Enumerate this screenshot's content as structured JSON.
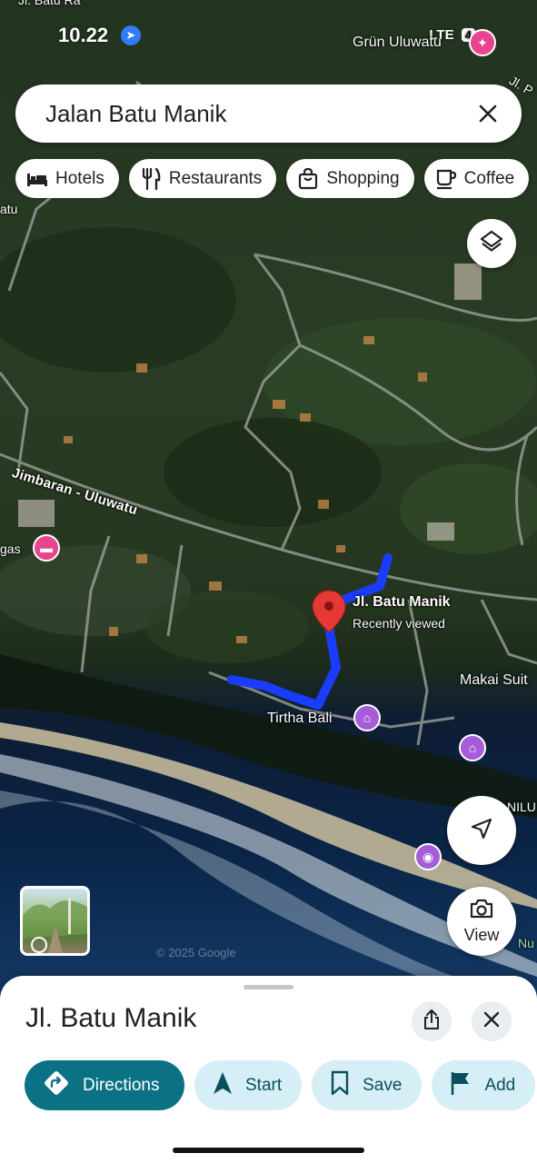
{
  "status_bar": {
    "time": "10.22",
    "network": "LTE",
    "battery": "4"
  },
  "search": {
    "query": "Jalan Batu Manik",
    "clear_icon": "close-icon"
  },
  "chips": [
    {
      "label": "Hotels",
      "icon": "bed-icon"
    },
    {
      "label": "Restaurants",
      "icon": "fork-knife-icon"
    },
    {
      "label": "Shopping",
      "icon": "shopping-bag-icon"
    },
    {
      "label": "Coffee",
      "icon": "coffee-cup-icon"
    }
  ],
  "map": {
    "labels": {
      "top_left": "Jl. Batu Ra",
      "top_right_place": "Grün Uluwatu",
      "top_right_road": "Jl. P",
      "left_edge": "atu",
      "road_main": "Jimbaran - Uluwatu",
      "left_gas": "gas",
      "selected_place": "Jl. Batu Manik",
      "selected_sub": "Recently viewed",
      "temple": "Tirtha Bali",
      "right_resort": "Makai Suit",
      "right_edge": "NILU",
      "bottom_right": "Nu"
    },
    "copyright": "© 2025 Google",
    "route_color": "#1a3cff",
    "pin_color": "#e53935"
  },
  "map_buttons": {
    "view_label": "View"
  },
  "place": {
    "title": "Jl. Batu Manik"
  },
  "actions": [
    {
      "label": "Directions",
      "icon": "directions-icon",
      "primary": true
    },
    {
      "label": "Start",
      "icon": "navigation-arrow-icon",
      "primary": false
    },
    {
      "label": "Save",
      "icon": "bookmark-icon",
      "primary": false
    },
    {
      "label": "Add",
      "icon": "flag-icon",
      "primary": false
    }
  ],
  "colors": {
    "primary_action": "#0b7285",
    "secondary_action": "#d6eef6"
  }
}
